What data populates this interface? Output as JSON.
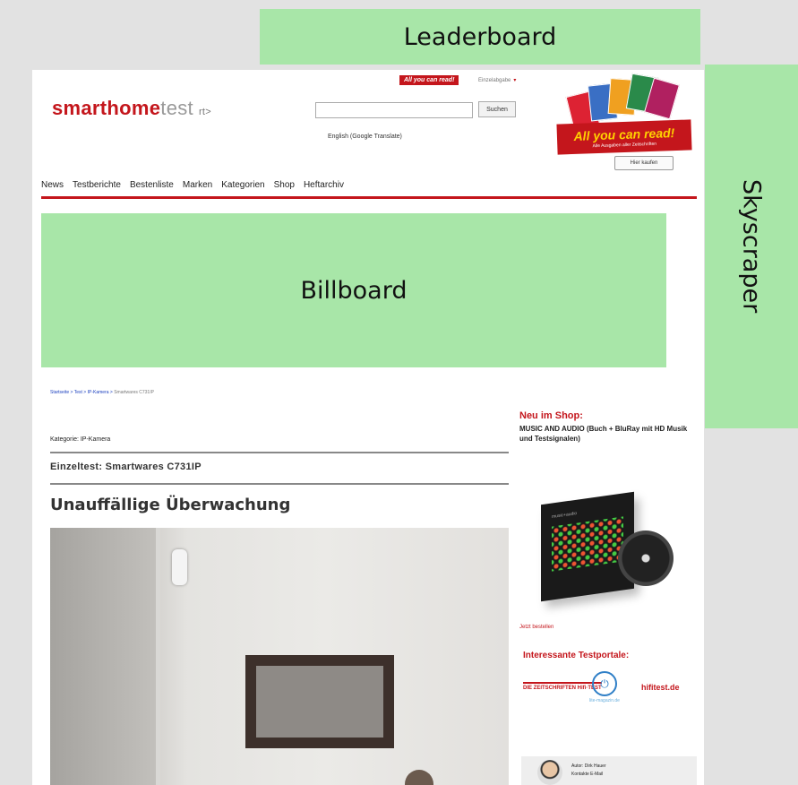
{
  "ads": {
    "leaderboard": "Leaderboard",
    "skyscraper": "Skyscraper",
    "billboard": "Billboard"
  },
  "header": {
    "logo_bold": "smarthome",
    "logo_light": "test",
    "logo_sub": "rt>",
    "search_button": "Suchen",
    "translate": "English (Google Translate)",
    "all_you_can_read_small": "All you can read!",
    "top_link": "Einzelabgabe",
    "promo_title": "All you can read!",
    "promo_tagline": "Alle Ausgaben aller Zeitschriften",
    "promo_button": "Hier kaufen"
  },
  "nav": {
    "items": [
      "News",
      "Testberichte",
      "Bestenliste",
      "Marken",
      "Kategorien",
      "Shop",
      "Heftarchiv"
    ]
  },
  "article": {
    "breadcrumb": "Startseite > Test > IP-Kamera >",
    "breadcrumb_current": "Smartwares C731IP",
    "kategorie": "Kategorie: IP-Kamera",
    "einzeltest": "Einzeltest: Smartwares C731IP",
    "headline": "Unauffällige Überwachung"
  },
  "sidebar": {
    "shop_title": "Neu im Shop:",
    "shop_product": "MUSIC AND AUDIO (Buch + BluRay mit HD Musik und Testsignalen)",
    "dvd_label": "music+audio",
    "order_link": "Jetzt bestellen",
    "portals_title": "Interessante Testportale:",
    "portal_1": "DIE ZEITSCHRIFTEN Hifi·TEST",
    "portal_2_icon": "⏻",
    "portal_2": "lite-magazin.de",
    "portal_3": "hifitest.de",
    "author_line1": "Autor: Dirk Hauer",
    "author_line2": "Kontakte E-Mail"
  },
  "colors": {
    "brand_red": "#c4161c",
    "ad_green": "#a8e6a8"
  }
}
